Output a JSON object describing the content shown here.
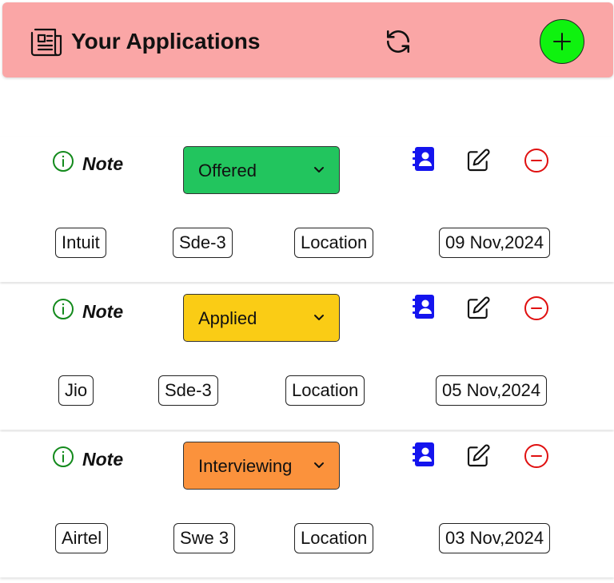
{
  "header": {
    "title": "Your Applications",
    "icons": {
      "title": "newspaper-icon",
      "refresh": "refresh-icon",
      "add": "plus-icon"
    },
    "add_button_color": "#0ff20f",
    "background": "#faa6a6"
  },
  "applications": [
    {
      "note_label": "Note",
      "status": "Offered",
      "status_color": "#22c55e",
      "company": "Intuit",
      "role": "Sde-3",
      "location": "Location",
      "date": "09 Nov,2024"
    },
    {
      "note_label": "Note",
      "status": "Applied",
      "status_color": "#facc15",
      "company": "Jio",
      "role": "Sde-3",
      "location": "Location",
      "date": "05 Nov,2024"
    },
    {
      "note_label": "Note",
      "status": "Interviewing",
      "status_color": "#fb923c",
      "company": "Airtel",
      "role": "Swe 3",
      "location": "Location",
      "date": "03 Nov,2024"
    }
  ],
  "card_icons": {
    "note": "info-icon",
    "status": "chevron-down-icon",
    "contact": "contact-book-icon",
    "edit": "edit-icon",
    "remove": "remove-icon"
  }
}
